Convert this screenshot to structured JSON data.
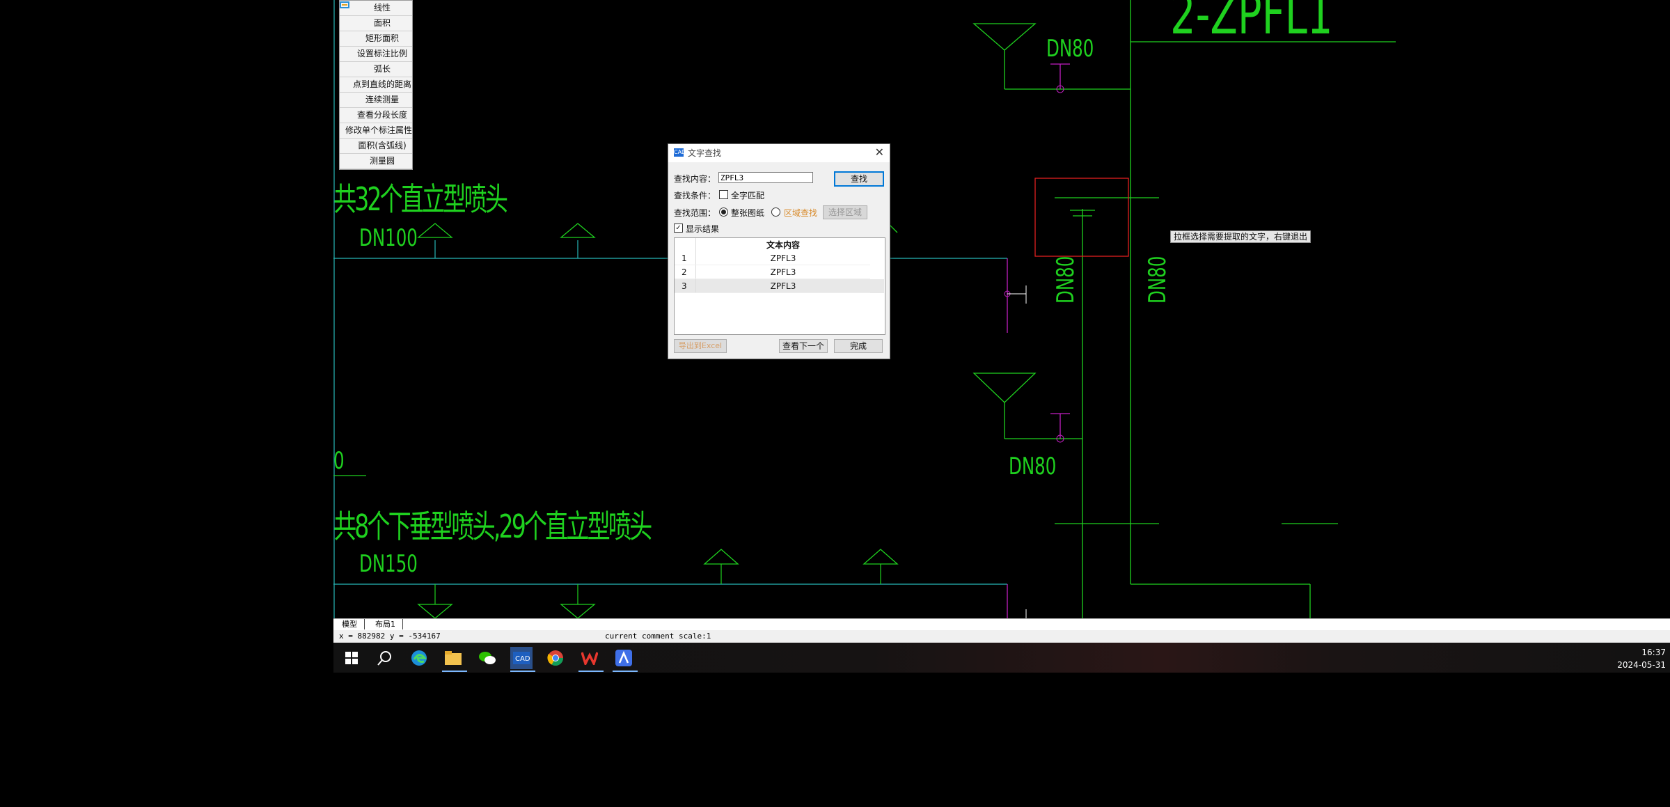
{
  "measure_menu": {
    "items": [
      {
        "label": "线性",
        "icon": "linear-dimension-icon"
      },
      {
        "label": "面积",
        "icon": "area-icon"
      },
      {
        "label": "矩形面积",
        "icon": "rectangle-area-icon"
      },
      {
        "label": "设置标注比例",
        "icon": "scale-icon"
      },
      {
        "label": "弧长",
        "icon": "arc-length-icon"
      },
      {
        "label": "点到直线的距离",
        "icon": "point-line-distance-icon"
      },
      {
        "label": "连续测量",
        "icon": "continuous-measure-icon"
      },
      {
        "label": "查看分段长度",
        "icon": "segment-length-icon"
      },
      {
        "label": "修改单个标注属性",
        "icon": "edit-dimension-icon"
      },
      {
        "label": "面积(含弧线)",
        "icon": "arc-area-icon"
      },
      {
        "label": "测量圆",
        "icon": "measure-circle-icon"
      }
    ]
  },
  "drawing": {
    "texts": {
      "t1": "共32个直立型喷头",
      "t2": "DN100",
      "t3": "共8个下垂型喷头,29个直立型喷头",
      "t4": "DN150",
      "t5": "DN80",
      "t6": "DN80",
      "t7": "DN80",
      "t8": "DN80",
      "t9": "2-ZPFL1",
      "t10": "0"
    },
    "colors": {
      "green": "#1fd11f",
      "cyan": "#27b8b8",
      "magenta": "#c21fc2",
      "red": "#e02020",
      "white": "#ffffff"
    }
  },
  "tooltip": "拉框选择需要提取的文字，右键退出",
  "dialog": {
    "title": "文字查找",
    "find_label": "查找内容：",
    "find_value": "ZPFL3",
    "find_button": "查找",
    "condition_label": "查找条件：",
    "whole_word_label": "全字匹配",
    "scope_label": "查找范围：",
    "scope_whole": "整张图纸",
    "scope_area": "区域查找",
    "select_area_button": "选择区域",
    "show_results_label": "显示结果",
    "results_header": "文本内容",
    "results": [
      {
        "index": "1",
        "text": "ZPFL3"
      },
      {
        "index": "2",
        "text": "ZPFL3"
      },
      {
        "index": "3",
        "text": "ZPFL3"
      }
    ],
    "export_button": "导出到Excel",
    "next_button": "查看下一个",
    "done_button": "完成"
  },
  "tabs": {
    "model": "模型",
    "layout": "布局1"
  },
  "status": {
    "coords": "x = 882982  y = -534167",
    "scale": "current comment scale:1"
  },
  "taskbar": {
    "icons": [
      "windows-start-icon",
      "search-icon",
      "edge-icon",
      "file-explorer-icon",
      "wechat-icon",
      "cad-viewer-icon",
      "chrome-icon",
      "wps-icon",
      "app-icon"
    ],
    "time": "16:37",
    "date": "2024-05-31"
  }
}
